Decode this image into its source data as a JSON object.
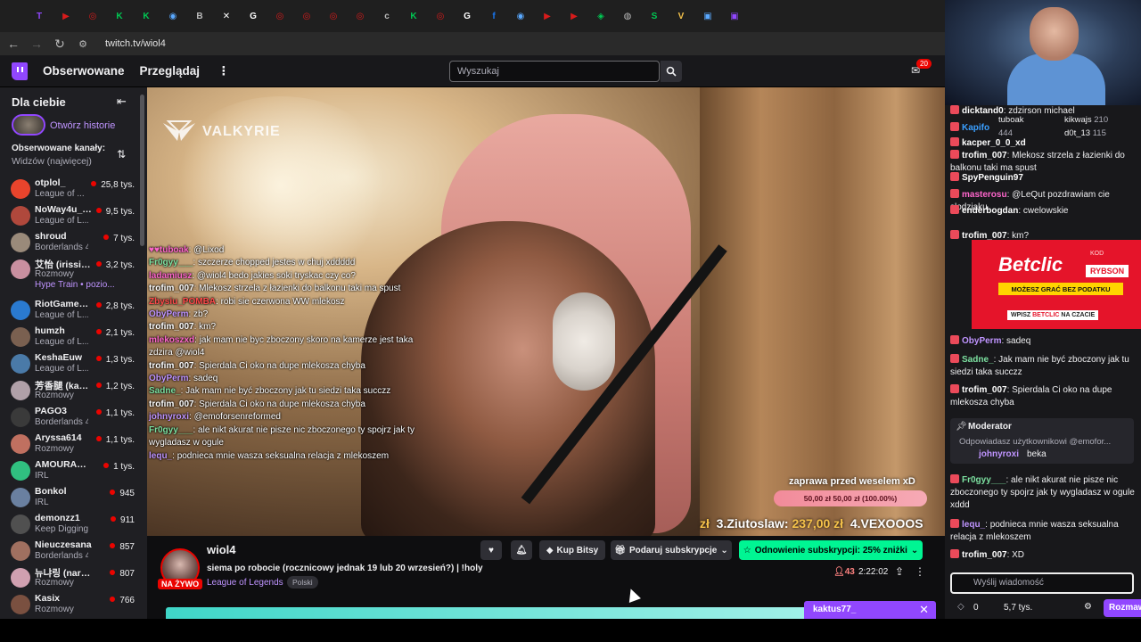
{
  "browser": {
    "url": "twitch.tv/wiol4",
    "tabs": [
      {
        "color": "#9147ff",
        "glyph": "T"
      },
      {
        "color": "#d81b1b",
        "glyph": "▶"
      },
      {
        "color": "#d81b1b",
        "glyph": "◎"
      },
      {
        "color": "#00c853",
        "glyph": "K"
      },
      {
        "color": "#00c853",
        "glyph": "K"
      },
      {
        "color": "#5aa9ff",
        "glyph": "◉"
      },
      {
        "color": "#bbbbbb",
        "glyph": "B"
      },
      {
        "color": "#ffffff",
        "glyph": "✕"
      },
      {
        "color": "#ffffff",
        "glyph": "G"
      },
      {
        "color": "#d81b1b",
        "glyph": "◎"
      },
      {
        "color": "#d81b1b",
        "glyph": "◎"
      },
      {
        "color": "#d81b1b",
        "glyph": "◎"
      },
      {
        "color": "#d81b1b",
        "glyph": "◎"
      },
      {
        "color": "#bbbbbb",
        "glyph": "c"
      },
      {
        "color": "#00c853",
        "glyph": "K"
      },
      {
        "color": "#d81b1b",
        "glyph": "◎"
      },
      {
        "color": "#ffffff",
        "glyph": "G"
      },
      {
        "color": "#1877f2",
        "glyph": "f"
      },
      {
        "color": "#5aa9ff",
        "glyph": "◉"
      },
      {
        "color": "#d81b1b",
        "glyph": "▶"
      },
      {
        "color": "#d81b1b",
        "glyph": "▶"
      },
      {
        "color": "#00c853",
        "glyph": "◈"
      },
      {
        "color": "#bbbbbb",
        "glyph": "◍"
      },
      {
        "color": "#00c853",
        "glyph": "S"
      },
      {
        "color": "#f5c24a",
        "glyph": "V"
      },
      {
        "color": "#5aa9ff",
        "glyph": "▣"
      },
      {
        "color": "#9147ff",
        "glyph": "▣"
      }
    ]
  },
  "topnav": {
    "following": "Obserwowane",
    "browse": "Przeglądaj",
    "search_placeholder": "Wyszukaj",
    "notif_count": "20"
  },
  "sidebar": {
    "title": "Dla ciebie",
    "story_link": "Otwórz historie",
    "followed_title": "Obserwowane kanały:",
    "followed_sub": "Widzów (najwięcej)",
    "channels": [
      {
        "name": "otplol_",
        "game": "League of ...",
        "viewers": "25,8 tys.",
        "color": "#e8442c"
      },
      {
        "name": "NoWay4u_Sir",
        "game": "League of L...",
        "viewers": "9,5 tys.",
        "color": "#b0483c"
      },
      {
        "name": "shroud",
        "game": "Borderlands 4",
        "viewers": "7 tys.",
        "color": "#9a8a7a"
      },
      {
        "name": "艾怡 (irissiri...",
        "game": "Rozmowy",
        "viewers": "3,2 tys.",
        "color": "#c98fa0"
      },
      {
        "name": "RiotGamesT...",
        "game": "League of L...",
        "viewers": "2,8 tys.",
        "color": "#2a7ad0"
      },
      {
        "name": "humzh",
        "game": "League of L...",
        "viewers": "2,1 tys.",
        "color": "#7a6050"
      },
      {
        "name": "KeshaEuw",
        "game": "League of L...",
        "viewers": "1,3 tys.",
        "color": "#4a7aa8"
      },
      {
        "name": "芳香腿 (kawa...",
        "game": "Rozmowy",
        "viewers": "1,2 tys.",
        "color": "#b0a0a8"
      },
      {
        "name": "PAGO3",
        "game": "Borderlands 4",
        "viewers": "1,1 tys.",
        "color": "#3a3a3a"
      },
      {
        "name": "Aryssa614",
        "game": "Rozmowy",
        "viewers": "1,1 tys.",
        "color": "#c07060"
      },
      {
        "name": "AMOURANTH",
        "game": "IRL",
        "viewers": "1 tys.",
        "color": "#30c080"
      },
      {
        "name": "Bonkol",
        "game": "IRL",
        "viewers": "945",
        "color": "#6a80a0"
      },
      {
        "name": "demonzz1",
        "game": "Keep Digging",
        "viewers": "911",
        "color": "#505050"
      },
      {
        "name": "Nieuczesana",
        "game": "Borderlands 4",
        "viewers": "857",
        "color": "#a07060"
      },
      {
        "name": "뉴냐링 (narang_...",
        "game": "Rozmowy",
        "viewers": "807",
        "color": "#d0a0b0"
      },
      {
        "name": "Kasix",
        "game": "Rozmowy",
        "viewers": "766",
        "color": "#7a5040"
      }
    ],
    "hype_train": "Hype Train • pozio..."
  },
  "video": {
    "brand": "VALKYRIE",
    "overlay_chat": [
      {
        "user": "♥♥tuboak",
        "text": "@Lixod",
        "color": "#ff66cc"
      },
      {
        "user": "Fr0gyy___",
        "text": "szczerze chopped jestes w chuj xddddd",
        "color": "#7ce0a0"
      },
      {
        "user": "ladamiusz",
        "text": "@wiol4 bedo jakies soki tryskac czy co?",
        "color": "#ff66cc"
      },
      {
        "user": "trofim_007",
        "text": "Mlekosz strzela z łazienki do balkonu taki ma spust",
        "color": "#ffffff"
      },
      {
        "user": "Zbysiu_POMBA",
        "text": "robi sie czerwona WW mlekosz",
        "color": "#ff4a4a"
      },
      {
        "user": "ObyPerm",
        "text": "zb?",
        "color": "#bf94ff"
      },
      {
        "user": "trofim_007",
        "text": "km?",
        "color": "#ffffff"
      },
      {
        "user": "mlekoszxd",
        "text": "jak mam nie byc zboczony skoro na kamerze jest taka zdzira @wiol4",
        "color": "#ff66cc"
      },
      {
        "user": "trofim_007",
        "text": "Spierdala Ci oko na dupe mlekosza chyba",
        "color": "#ffffff"
      },
      {
        "user": "ObyPerm",
        "text": "sadeq",
        "color": "#bf94ff"
      },
      {
        "user": "Sadne_",
        "text": "Jak mam nie być zboczony jak tu siedzi taka succzz",
        "color": "#7ce0a0"
      },
      {
        "user": "trofim_007",
        "text": "Spierdala Ci oko na dupe mlekosza chyba",
        "color": "#ffffff"
      },
      {
        "user": "johnyroxi",
        "text": "@emoforsenreformed",
        "color": "#bf94ff"
      },
      {
        "user": "Fr0gyy___",
        "text": "ale nikt akurat nie pisze nic zboczonego ty spojrz jak ty wygladasz w ogule",
        "color": "#7ce0a0"
      },
      {
        "user": "lequ_",
        "text": "podnieca mnie wasza seksualna relacja z mlekoszem",
        "color": "#bf94ff"
      }
    ],
    "goal_title": "zaprawa przed weselem xD",
    "goal_progress_text": "50,00 zł   50,00 zł (100.00%)",
    "goal_fraction": 1.0,
    "ticker": {
      "prefix": "zł",
      "entry1": "3.Ziutoslaw:",
      "amount1": "237,00 zł",
      "entry2": "4.VEXOOOS"
    }
  },
  "stream": {
    "streamer": "wiol4",
    "live": "NA ŻYWO",
    "title": "siema po robocie (rocznicowy jednak 19 lub 20 wrzesień?) | !holy",
    "game": "League of Legends",
    "tag": "Polski",
    "buy_bits": "Kup Bitsy",
    "gift_sub": "Podaruj subskrypcje",
    "renew": "Odnowienie subskrypcji: 25% zniżki",
    "viewers": "43",
    "uptime": "2:22:02"
  },
  "chat": {
    "messages": [
      {
        "user": "dicktand0",
        "text": "zdzirson michael",
        "color": "#ffffff"
      },
      {
        "user": "Kapifo",
        "text": "",
        "color": "#3a9fff"
      },
      {
        "user": "kacper_0_0_xd",
        "text": "",
        "color": "#ffffff"
      },
      {
        "user": "trofim_007",
        "text": "Mlekosz strzela z łazienki do balkonu taki ma spust",
        "color": "#ffffff"
      },
      {
        "user": "SpyPenguin97",
        "text": "",
        "color": "#ffffff"
      },
      {
        "user": "masterosu",
        "text": "@LeQut pozdrawiam cie słodziaku",
        "color": "#ff66cc"
      },
      {
        "user": "enderbogdan",
        "text": "cwelowskie",
        "color": "#ffffff"
      },
      {
        "user": "trofim_007",
        "text": "km?",
        "color": "#ffffff"
      },
      {
        "user": "ObyPerm",
        "text": "sadeq",
        "color": "#bf94ff"
      },
      {
        "user": "Sadne_",
        "text": "Jak mam nie być zboczony jak tu siedzi taka succzz",
        "color": "#7ce0a0"
      },
      {
        "user": "trofim_007",
        "text": "Spierdala Ci oko na dupe mlekosza chyba",
        "color": "#ffffff"
      },
      {
        "user": "Fr0gyy___",
        "text": "ale nikt akurat nie pisze nic zboczonego ty spojrz jak ty wygladasz w ogule xddd",
        "color": "#7ce0a0"
      },
      {
        "user": "lequ_",
        "text": "podnieca mnie wasza seksualna relacja z mlekoszem",
        "color": "#bf94ff"
      },
      {
        "user": "trofim_007",
        "text": "XD",
        "color": "#ffffff"
      }
    ],
    "hype_users": [
      {
        "name": "tuboak",
        "count": ""
      },
      {
        "name": "kikwajs",
        "count": "210"
      },
      {
        "name": "",
        "count": "444"
      },
      {
        "name": "d0t_13",
        "count": "115"
      }
    ],
    "ad": {
      "brand": "Betclic",
      "code_label": "KOD",
      "code": "RYBSON",
      "strip": "MOŻESZ GRAĆ BEZ PODATKU",
      "cta_prefix": "WPISZ",
      "cta_brand": "BETCLIC",
      "cta_suffix": "NA CZACIE"
    },
    "moderator": {
      "label": "Moderator",
      "reply_to": "Odpowiadasz użytkownikowi @emofor...",
      "reply_user": "johnyroxi",
      "reply_text": "beka"
    },
    "input_placeholder": "Wyślij wiadomość",
    "points": "0",
    "gold": "5,7 tys.",
    "chat_button": "Rozmawiaj"
  },
  "popup": {
    "user": "kaktus77_"
  }
}
